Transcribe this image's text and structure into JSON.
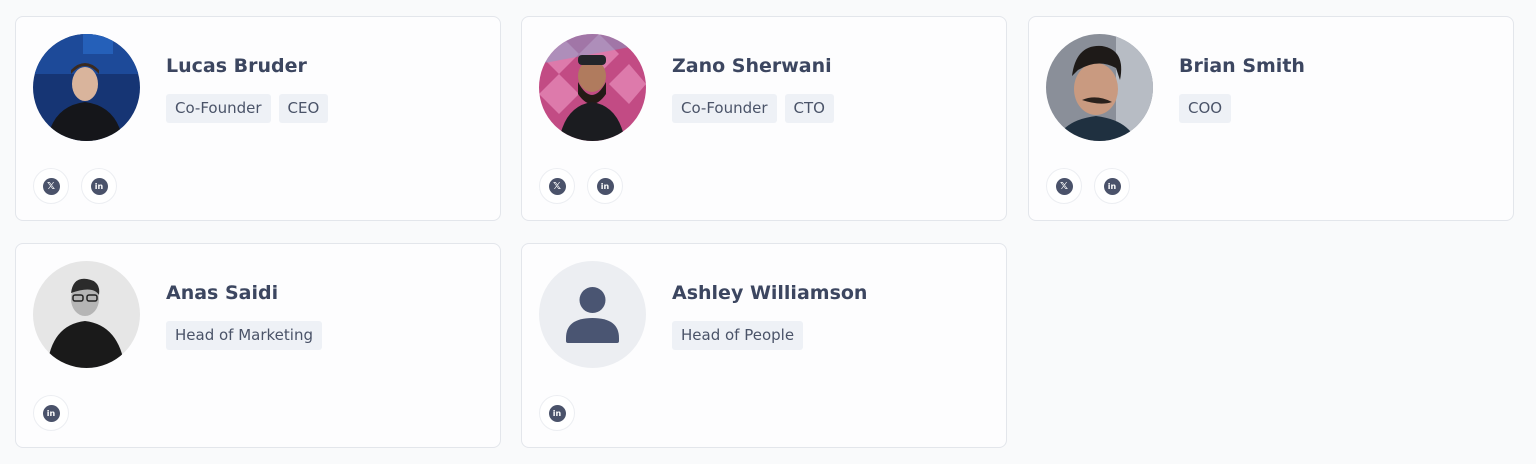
{
  "team": [
    {
      "name": "Lucas Bruder",
      "tags": [
        "Co-Founder",
        "CEO"
      ],
      "socials": [
        "x",
        "linkedin"
      ],
      "avatar": "photo-dark-blue"
    },
    {
      "name": "Zano Sherwani",
      "tags": [
        "Co-Founder",
        "CTO"
      ],
      "socials": [
        "x",
        "linkedin"
      ],
      "avatar": "photo-pink-pattern"
    },
    {
      "name": "Brian Smith",
      "tags": [
        "COO"
      ],
      "socials": [
        "x",
        "linkedin"
      ],
      "avatar": "photo-gray"
    },
    {
      "name": "Anas Saidi",
      "tags": [
        "Head of Marketing"
      ],
      "socials": [
        "linkedin"
      ],
      "avatar": "photo-bw"
    },
    {
      "name": "Ashley Williamson",
      "tags": [
        "Head of People"
      ],
      "socials": [
        "linkedin"
      ],
      "avatar": "placeholder-user"
    }
  ],
  "icons": {
    "x": "x-logo-icon",
    "linkedin": "linkedin-icon"
  },
  "glyphs": {
    "x": "𝕏",
    "linkedin": "in"
  },
  "colors": {
    "social_icon": "#4a526a",
    "tag_bg": "#eef1f6",
    "name": "#3c4660"
  }
}
